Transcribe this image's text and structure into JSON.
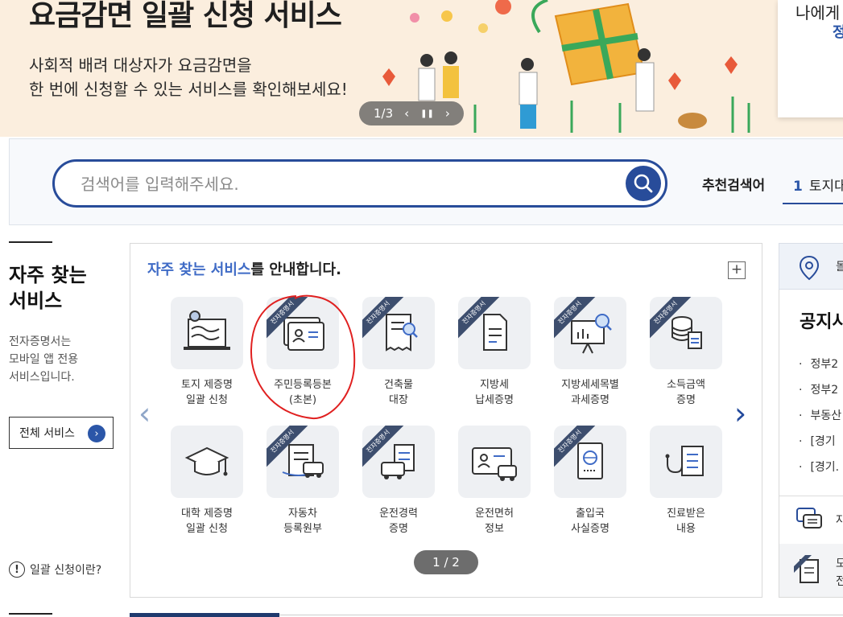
{
  "hero": {
    "title": "요금감면 일괄 신청 서비스",
    "subtitle_line1": "사회적 배려 대상자가 요금감면을",
    "subtitle_line2": "한 번에 신청할 수 있는 서비스를 확인해보세요!",
    "carousel_counter": "1/3",
    "prev_label": "‹",
    "pause_label": "❚❚",
    "next_label": "›",
    "side_card_line1": "나에게",
    "side_card_line2": "정"
  },
  "search": {
    "placeholder": "검색어를 입력해주세요.",
    "recommended_label": "추천검색어",
    "recommended_rank": "1",
    "recommended_item": "토지대"
  },
  "left": {
    "title_line1": "자주 찾는",
    "title_line2": "서비스",
    "desc_line1": "전자증명서는",
    "desc_line2": "모바일 앱 전용",
    "desc_line3": "서비스입니다.",
    "all_services_label": "전체 서비스",
    "all_services_arrow": "›",
    "help_icon": "!",
    "help_label": "일괄 신청이란?"
  },
  "services": {
    "title_highlight": "자주 찾는 서비스",
    "title_rest": "를 안내합니다.",
    "more_label": "+",
    "prev_arrow": "‹",
    "next_arrow": "›",
    "ribbon_text": "전자증명서",
    "pager": "1 / 2",
    "items": [
      {
        "line1": "토지 제증명",
        "line2": "일괄 신청",
        "icon": "land-map-icon",
        "ribbon": false
      },
      {
        "line1": "주민등록등본",
        "line2": "(초본)",
        "icon": "id-card-icon",
        "ribbon": true
      },
      {
        "line1": "건축물",
        "line2": "대장",
        "icon": "building-document-search-icon",
        "ribbon": true
      },
      {
        "line1": "지방세",
        "line2": "납세증명",
        "icon": "tax-document-icon",
        "ribbon": true
      },
      {
        "line1": "지방세세목별",
        "line2": "과세증명",
        "icon": "presentation-search-icon",
        "ribbon": true
      },
      {
        "line1": "소득금액",
        "line2": "증명",
        "icon": "coins-document-icon",
        "ribbon": true
      },
      {
        "line1": "대학 제증명",
        "line2": "일괄 신청",
        "icon": "graduation-cap-icon",
        "ribbon": false
      },
      {
        "line1": "자동차",
        "line2": "등록원부",
        "icon": "car-registration-icon",
        "ribbon": true
      },
      {
        "line1": "운전경력",
        "line2": "증명",
        "icon": "driving-record-icon",
        "ribbon": true
      },
      {
        "line1": "운전면허",
        "line2": "정보",
        "icon": "driver-license-icon",
        "ribbon": false
      },
      {
        "line1": "출입국",
        "line2": "사실증명",
        "icon": "passport-icon",
        "ribbon": true
      },
      {
        "line1": "진료받은",
        "line2": "내용",
        "icon": "stethoscope-chart-icon",
        "ribbon": false
      }
    ]
  },
  "right": {
    "top_text": "돌",
    "notice_title": "공지사",
    "notices": [
      "정부2",
      "정부2",
      "부동산",
      "[경기",
      "[경기."
    ],
    "bullet": "·",
    "chat_text": "자",
    "bottom_text1": "모",
    "bottom_text2": "전"
  },
  "colors": {
    "brand_blue": "#284c9a",
    "highlight_blue": "#3f6bc6",
    "hero_bg": "#fbeede",
    "annotation_red": "#e02020"
  }
}
